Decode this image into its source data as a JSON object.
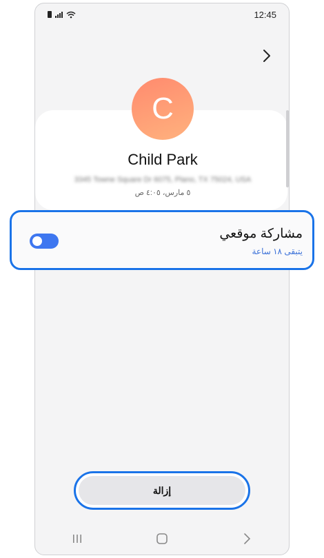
{
  "status_bar": {
    "time": "12:45"
  },
  "contact": {
    "avatar_letter": "C",
    "name": "Child Park",
    "address": "3345 Towne Square Dr 6075, Plano, TX 75024, USA",
    "timestamp": "٥ مارس، ٤:٠٥ ص"
  },
  "location_sharing": {
    "title": "مشاركة موقعي",
    "subtitle": "يتبقى ١٨ ساعة",
    "enabled": true
  },
  "actions": {
    "remove_label": "إزالة"
  },
  "icons": {
    "forward": "chevron-right-icon",
    "recents": "recents-icon",
    "home": "home-icon",
    "back": "back-icon"
  },
  "colors": {
    "accent": "#1a73e8",
    "toggle": "#3e77f0",
    "avatar_start": "#ff8a6e",
    "avatar_end": "#ffb27e"
  }
}
